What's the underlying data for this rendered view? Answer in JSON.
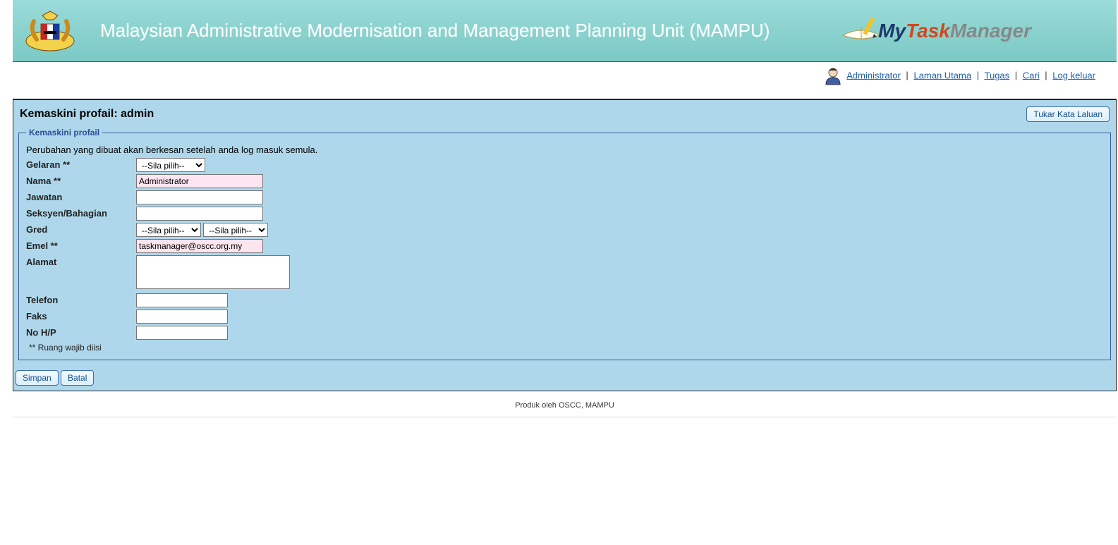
{
  "header": {
    "title": "Malaysian Administrative Modernisation and Management Planning Unit (MAMPU)",
    "logo": {
      "my": "My",
      "task": "Task",
      "manager": "Manager"
    }
  },
  "nav": {
    "user": "Administrator",
    "links": {
      "home": "Laman Utama",
      "tasks": "Tugas",
      "search": "Cari",
      "logout": "Log keluar"
    }
  },
  "page": {
    "title": "Kemaskini profail: admin",
    "change_password": "Tukar Kata Laluan"
  },
  "form": {
    "legend": "Kemaskini profail",
    "note": "Perubahan yang dibuat akan berkesan setelah anda log masuk semula.",
    "labels": {
      "gelaran": "Gelaran **",
      "nama": "Nama **",
      "jawatan": "Jawatan",
      "seksyen": "Seksyen/Bahagian",
      "gred": "Gred",
      "emel": "Emel **",
      "alamat": "Alamat",
      "telefon": "Telefon",
      "faks": "Faks",
      "nohp": "No H/P"
    },
    "values": {
      "gelaran_select": "--Sila pilih--",
      "nama": "Administrator",
      "jawatan": "",
      "seksyen": "",
      "gred_select1": "--Sila pilih--",
      "gred_select2": "--Sila pilih--",
      "emel": "taskmanager@oscc.org.my",
      "alamat": "",
      "telefon": "",
      "faks": "",
      "nohp": ""
    },
    "required_note": "** Ruang wajib diisi"
  },
  "buttons": {
    "save": "Simpan",
    "cancel": "Batal"
  },
  "footer": "Produk oleh OSCC, MAMPU"
}
